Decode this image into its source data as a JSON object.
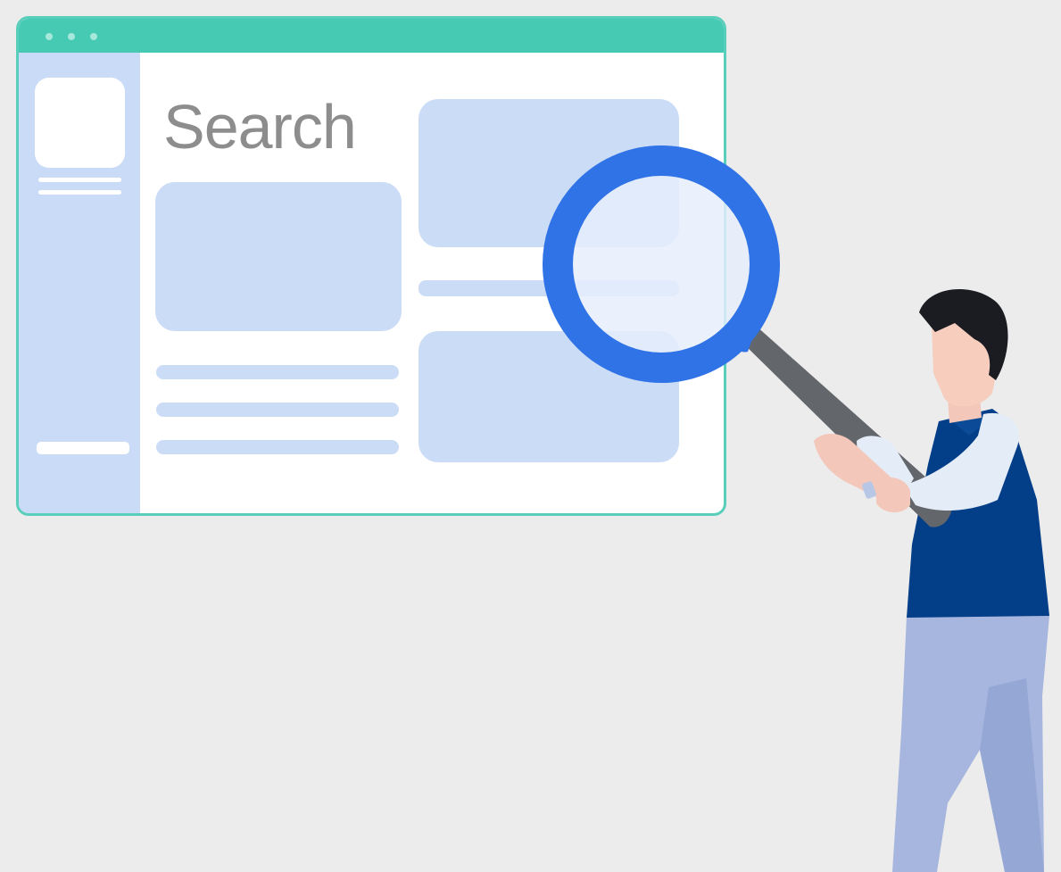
{
  "screen": {
    "title": "Search"
  },
  "icons": {
    "window_dots": "three-dots-icon",
    "magnifier": "magnifying-glass-icon",
    "person": "person-figure"
  },
  "colors": {
    "background": "#ececec",
    "accent_teal": "#47cab4",
    "placeholder_blue": "#cbdcf6",
    "lens_blue": "#2f73e6",
    "shirt_navy": "#033e88",
    "pants_blue": "#a4b3db",
    "title_gray": "#8d8d8d"
  }
}
